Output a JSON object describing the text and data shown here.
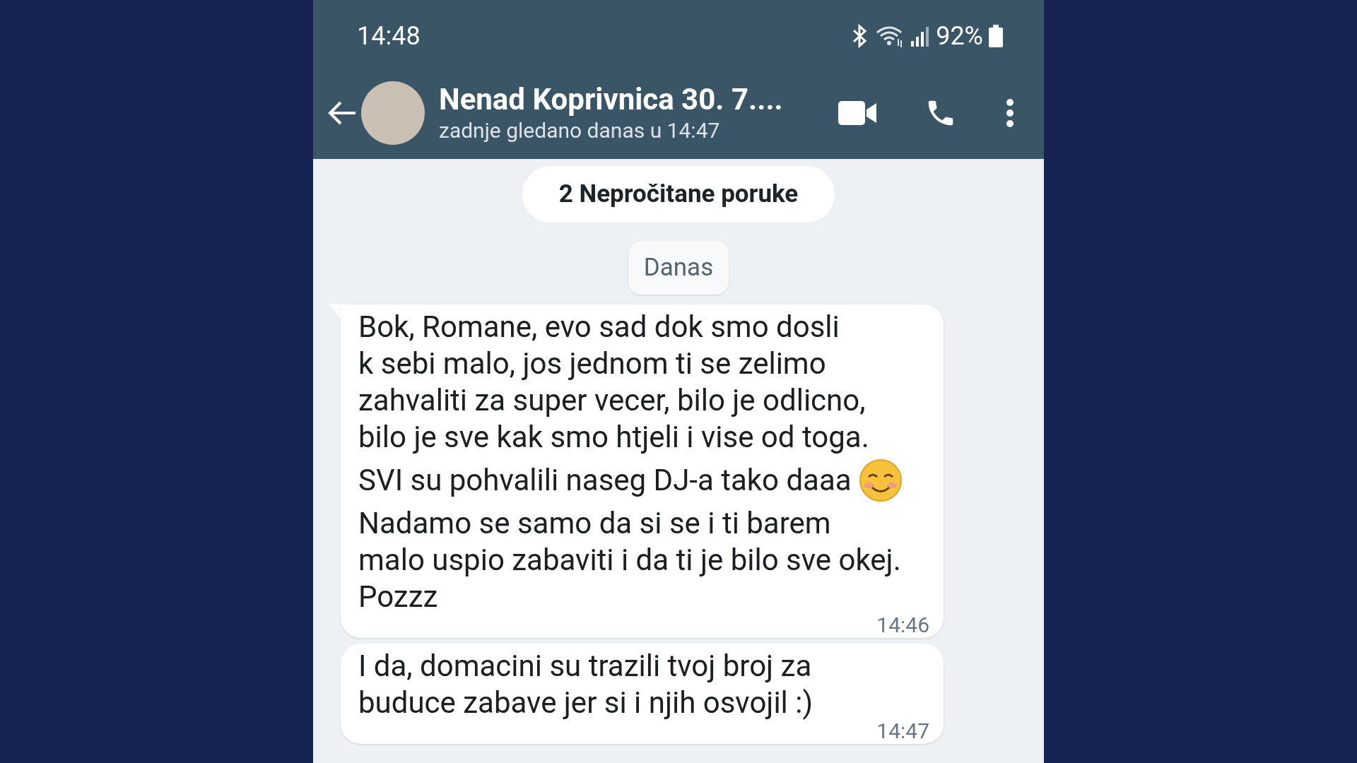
{
  "status_bar": {
    "time": "14:48",
    "battery": "92%"
  },
  "header": {
    "contact_name": "Nenad Koprivnica 30. 7....",
    "last_seen": "zadnje gledano danas u 14:47"
  },
  "unread_banner": "2 Nepročitane poruke",
  "date_chip": "Danas",
  "messages": [
    {
      "paragraphs": [
        {
          "text": "Bok, Romane, evo sad dok smo dosli\nk sebi malo, jos jednom ti se zelimo\nzahvaliti za super vecer, bilo je odlicno,\nbilo je sve kak smo htjeli i vise od toga.",
          "emoji": false
        },
        {
          "text": "SVI su pohvalili naseg DJ-a tako daaa",
          "emoji": true
        },
        {
          "text": "Nadamo se samo da si se i ti barem\nmalo uspio zabaviti i da ti je bilo sve okej.\nPozzz",
          "emoji": false
        }
      ],
      "time": "14:46",
      "tail": true
    },
    {
      "paragraphs": [
        {
          "text": "I da, domacini su trazili tvoj broj za\nbuduce zabave jer si i njih osvojil :)",
          "emoji": false
        }
      ],
      "time": "14:47",
      "tail": false
    }
  ]
}
